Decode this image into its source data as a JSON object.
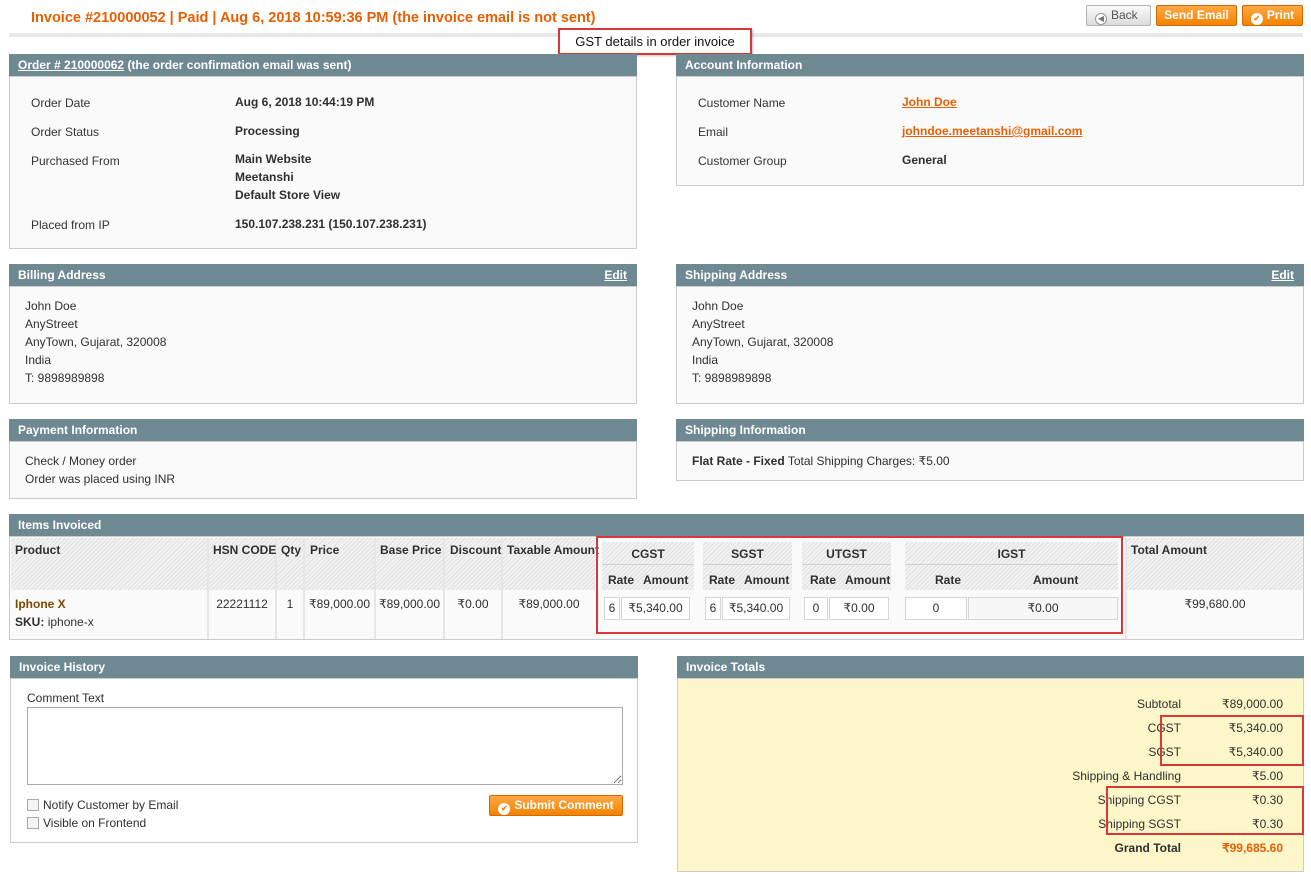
{
  "page": {
    "title": "Invoice #210000052 | Paid | Aug 6, 2018 10:59:36 PM (the invoice email is not sent)",
    "callout": "GST details in order invoice",
    "buttons": {
      "back": "Back",
      "send_email": "Send Email",
      "print": "Print"
    }
  },
  "order": {
    "header_link": "Order # 210000062",
    "header_note": "(the order confirmation email was sent)",
    "date_label": "Order Date",
    "date": "Aug 6, 2018 10:44:19 PM",
    "status_label": "Order Status",
    "status": "Processing",
    "purchased_label": "Purchased From",
    "purchased": [
      "Main Website",
      "Meetanshi",
      "Default Store View"
    ],
    "ip_label": "Placed from IP",
    "ip": "150.107.238.231 (150.107.238.231)"
  },
  "account": {
    "header": "Account Information",
    "name_label": "Customer Name",
    "name": "John Doe",
    "email_label": "Email",
    "email": "johndoe.meetanshi@gmail.com",
    "group_label": "Customer Group",
    "group": "General"
  },
  "billing": {
    "header": "Billing Address",
    "edit": "Edit",
    "lines": [
      "John Doe",
      "AnyStreet",
      "AnyTown, Gujarat, 320008",
      "India",
      "T: 9898989898"
    ]
  },
  "shipping": {
    "header": "Shipping Address",
    "edit": "Edit",
    "lines": [
      "John Doe",
      "AnyStreet",
      "AnyTown, Gujarat, 320008",
      "India",
      "T: 9898989898"
    ]
  },
  "payment": {
    "header": "Payment Information",
    "lines": [
      "Check / Money order",
      "Order was placed using INR"
    ]
  },
  "shipping_info": {
    "header": "Shipping Information",
    "method": "Flat Rate - Fixed",
    "charges": "Total Shipping Charges: ₹5.00"
  },
  "items": {
    "header": "Items Invoiced",
    "columns": [
      "Product",
      "HSN CODE",
      "Qty",
      "Price",
      "Base Price",
      "Discount",
      "Taxable Amount",
      "CGST",
      "SGST",
      "UTGST",
      "IGST",
      "Total Amount"
    ],
    "sub_rate": "Rate",
    "sub_amount": "Amount",
    "rows": [
      {
        "product": "Iphone X",
        "sku_label": "SKU:",
        "sku": "iphone-x",
        "hsn": "22221112",
        "qty": "1",
        "price": "₹89,000.00",
        "base_price": "₹89,000.00",
        "discount": "₹0.00",
        "taxable": "₹89,000.00",
        "cgst_rate": "6",
        "cgst_amount": "₹5,340.00",
        "sgst_rate": "6",
        "sgst_amount": "₹5,340.00",
        "utgst_rate": "0",
        "utgst_amount": "₹0.00",
        "igst_rate": "0",
        "igst_amount": "₹0.00",
        "total": "₹99,680.00"
      }
    ]
  },
  "history": {
    "header": "Invoice History",
    "comment_label": "Comment Text",
    "notify_label": "Notify Customer by Email",
    "visible_label": "Visible on Frontend",
    "submit": "Submit Comment"
  },
  "totals": {
    "header": "Invoice Totals",
    "rows": [
      {
        "label": "Subtotal",
        "value": "₹89,000.00"
      },
      {
        "label": "CGST",
        "value": "₹5,340.00"
      },
      {
        "label": "SGST",
        "value": "₹5,340.00"
      },
      {
        "label": "Shipping & Handling",
        "value": "₹5.00"
      },
      {
        "label": "Shipping CGST",
        "value": "₹0.30"
      },
      {
        "label": "Shipping SGST",
        "value": "₹0.30"
      }
    ],
    "grand_label": "Grand Total",
    "grand_value": "₹99,685.60"
  },
  "colors": {
    "accent": "#eb5e00",
    "header_bar": "#6f8992",
    "highlight": "#d9383b",
    "totals_bg": "#fcf6c8"
  }
}
